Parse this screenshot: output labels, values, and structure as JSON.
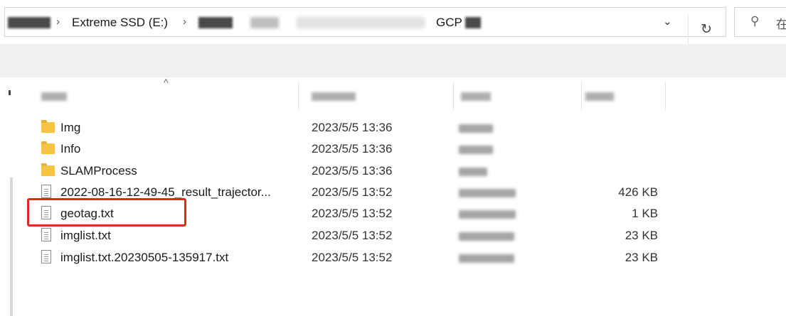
{
  "address_bar": {
    "drive": "Extreme SSD (E:)",
    "folder": "GCP",
    "separator": "›"
  },
  "search": {
    "placeholder": "在"
  },
  "icons": {
    "dropdown": "chevron-down-icon",
    "refresh": "refresh-icon",
    "search": "search-icon",
    "folder": "folder-icon",
    "file": "text-file-icon"
  },
  "files": [
    {
      "name": "Img",
      "date": "2023/5/5 13:36",
      "kind": "folder",
      "size": ""
    },
    {
      "name": "Info",
      "date": "2023/5/5 13:36",
      "kind": "folder",
      "size": ""
    },
    {
      "name": "SLAMProcess",
      "date": "2023/5/5 13:36",
      "kind": "folder",
      "size": ""
    },
    {
      "name": "2022-08-16-12-49-45_result_trajector...",
      "date": "2023/5/5 13:52",
      "kind": "file",
      "size": "426 KB"
    },
    {
      "name": "geotag.txt",
      "date": "2023/5/5 13:52",
      "kind": "file",
      "size": "1 KB"
    },
    {
      "name": "imglist.txt",
      "date": "2023/5/5 13:52",
      "kind": "file",
      "size": "23 KB"
    },
    {
      "name": "imglist.txt.20230505-135917.txt",
      "date": "2023/5/5 13:52",
      "kind": "file",
      "size": "23 KB"
    }
  ],
  "highlight": {
    "color": "#e0281e",
    "row": "geotag.txt"
  }
}
